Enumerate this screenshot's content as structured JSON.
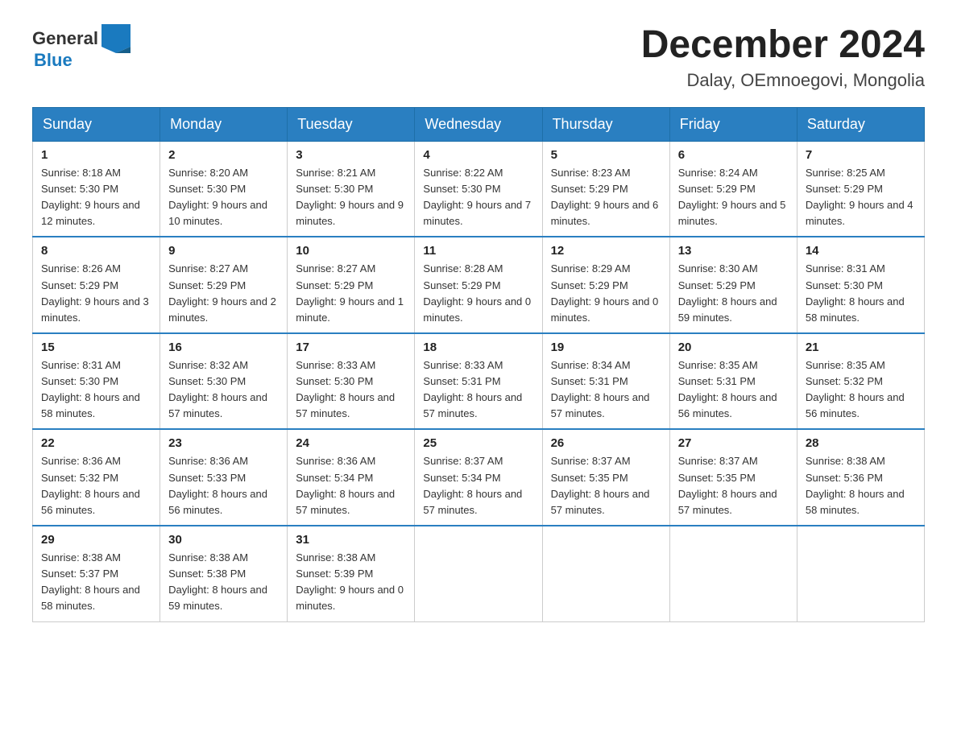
{
  "header": {
    "logo_general": "General",
    "logo_blue": "Blue",
    "month_title": "December 2024",
    "location": "Dalay, OEmnoegovi, Mongolia"
  },
  "days_of_week": [
    "Sunday",
    "Monday",
    "Tuesday",
    "Wednesday",
    "Thursday",
    "Friday",
    "Saturday"
  ],
  "weeks": [
    [
      {
        "day": "1",
        "sunrise": "8:18 AM",
        "sunset": "5:30 PM",
        "daylight": "9 hours and 12 minutes."
      },
      {
        "day": "2",
        "sunrise": "8:20 AM",
        "sunset": "5:30 PM",
        "daylight": "9 hours and 10 minutes."
      },
      {
        "day": "3",
        "sunrise": "8:21 AM",
        "sunset": "5:30 PM",
        "daylight": "9 hours and 9 minutes."
      },
      {
        "day": "4",
        "sunrise": "8:22 AM",
        "sunset": "5:30 PM",
        "daylight": "9 hours and 7 minutes."
      },
      {
        "day": "5",
        "sunrise": "8:23 AM",
        "sunset": "5:29 PM",
        "daylight": "9 hours and 6 minutes."
      },
      {
        "day": "6",
        "sunrise": "8:24 AM",
        "sunset": "5:29 PM",
        "daylight": "9 hours and 5 minutes."
      },
      {
        "day": "7",
        "sunrise": "8:25 AM",
        "sunset": "5:29 PM",
        "daylight": "9 hours and 4 minutes."
      }
    ],
    [
      {
        "day": "8",
        "sunrise": "8:26 AM",
        "sunset": "5:29 PM",
        "daylight": "9 hours and 3 minutes."
      },
      {
        "day": "9",
        "sunrise": "8:27 AM",
        "sunset": "5:29 PM",
        "daylight": "9 hours and 2 minutes."
      },
      {
        "day": "10",
        "sunrise": "8:27 AM",
        "sunset": "5:29 PM",
        "daylight": "9 hours and 1 minute."
      },
      {
        "day": "11",
        "sunrise": "8:28 AM",
        "sunset": "5:29 PM",
        "daylight": "9 hours and 0 minutes."
      },
      {
        "day": "12",
        "sunrise": "8:29 AM",
        "sunset": "5:29 PM",
        "daylight": "9 hours and 0 minutes."
      },
      {
        "day": "13",
        "sunrise": "8:30 AM",
        "sunset": "5:29 PM",
        "daylight": "8 hours and 59 minutes."
      },
      {
        "day": "14",
        "sunrise": "8:31 AM",
        "sunset": "5:30 PM",
        "daylight": "8 hours and 58 minutes."
      }
    ],
    [
      {
        "day": "15",
        "sunrise": "8:31 AM",
        "sunset": "5:30 PM",
        "daylight": "8 hours and 58 minutes."
      },
      {
        "day": "16",
        "sunrise": "8:32 AM",
        "sunset": "5:30 PM",
        "daylight": "8 hours and 57 minutes."
      },
      {
        "day": "17",
        "sunrise": "8:33 AM",
        "sunset": "5:30 PM",
        "daylight": "8 hours and 57 minutes."
      },
      {
        "day": "18",
        "sunrise": "8:33 AM",
        "sunset": "5:31 PM",
        "daylight": "8 hours and 57 minutes."
      },
      {
        "day": "19",
        "sunrise": "8:34 AM",
        "sunset": "5:31 PM",
        "daylight": "8 hours and 57 minutes."
      },
      {
        "day": "20",
        "sunrise": "8:35 AM",
        "sunset": "5:31 PM",
        "daylight": "8 hours and 56 minutes."
      },
      {
        "day": "21",
        "sunrise": "8:35 AM",
        "sunset": "5:32 PM",
        "daylight": "8 hours and 56 minutes."
      }
    ],
    [
      {
        "day": "22",
        "sunrise": "8:36 AM",
        "sunset": "5:32 PM",
        "daylight": "8 hours and 56 minutes."
      },
      {
        "day": "23",
        "sunrise": "8:36 AM",
        "sunset": "5:33 PM",
        "daylight": "8 hours and 56 minutes."
      },
      {
        "day": "24",
        "sunrise": "8:36 AM",
        "sunset": "5:34 PM",
        "daylight": "8 hours and 57 minutes."
      },
      {
        "day": "25",
        "sunrise": "8:37 AM",
        "sunset": "5:34 PM",
        "daylight": "8 hours and 57 minutes."
      },
      {
        "day": "26",
        "sunrise": "8:37 AM",
        "sunset": "5:35 PM",
        "daylight": "8 hours and 57 minutes."
      },
      {
        "day": "27",
        "sunrise": "8:37 AM",
        "sunset": "5:35 PM",
        "daylight": "8 hours and 57 minutes."
      },
      {
        "day": "28",
        "sunrise": "8:38 AM",
        "sunset": "5:36 PM",
        "daylight": "8 hours and 58 minutes."
      }
    ],
    [
      {
        "day": "29",
        "sunrise": "8:38 AM",
        "sunset": "5:37 PM",
        "daylight": "8 hours and 58 minutes."
      },
      {
        "day": "30",
        "sunrise": "8:38 AM",
        "sunset": "5:38 PM",
        "daylight": "8 hours and 59 minutes."
      },
      {
        "day": "31",
        "sunrise": "8:38 AM",
        "sunset": "5:39 PM",
        "daylight": "9 hours and 0 minutes."
      },
      null,
      null,
      null,
      null
    ]
  ]
}
